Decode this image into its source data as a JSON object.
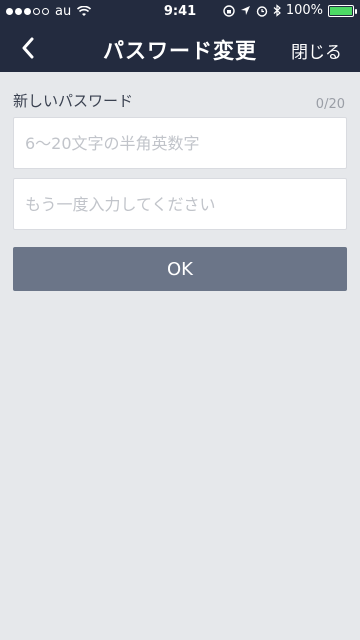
{
  "status_bar": {
    "carrier": "au",
    "time": "9:41",
    "battery_percent": "100%",
    "icons": [
      "signal-dots-icon",
      "wifi-icon",
      "orientation-lock-icon",
      "location-arrow-icon",
      "alarm-icon",
      "bluetooth-icon",
      "battery-icon"
    ]
  },
  "nav": {
    "title": "パスワード変更",
    "close_label": "閉じる",
    "back_icon": "chevron-left-icon"
  },
  "form": {
    "label": "新しいパスワード",
    "counter": "0/20",
    "password_placeholder": "6〜20文字の半角英数字",
    "confirm_placeholder": "もう一度入力してください",
    "ok_label": "OK"
  },
  "colors": {
    "nav_background": "#232b3f",
    "page_background": "#e6e8eb",
    "ok_button": "#6b7588",
    "battery_fill": "#4cd964"
  }
}
